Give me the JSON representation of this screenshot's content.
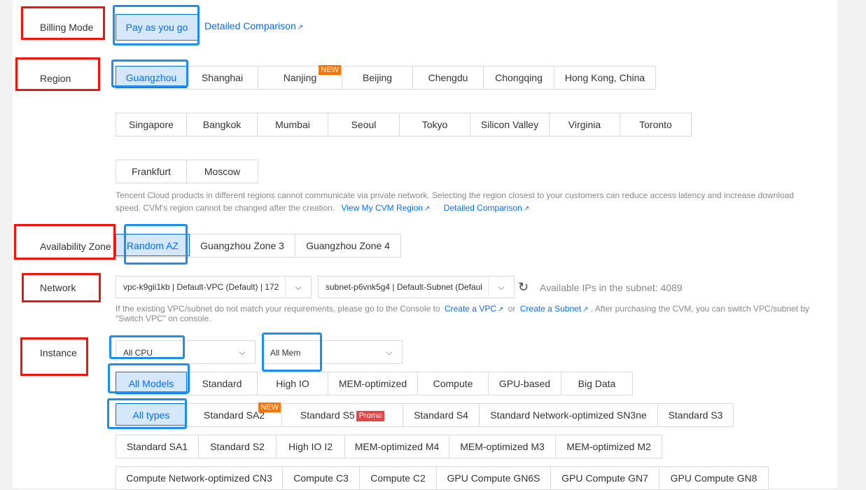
{
  "billing": {
    "label": "Billing Mode",
    "option": "Pay as you go",
    "comparison_link": "Detailed Comparison"
  },
  "region": {
    "label": "Region",
    "row1": [
      "Guangzhou",
      "Shanghai",
      "Nanjing",
      "Beijing",
      "Chengdu",
      "Chongqing",
      "Hong Kong, China"
    ],
    "row2": [
      "Singapore",
      "Bangkok",
      "Mumbai",
      "Seoul",
      "Tokyo",
      "Silicon Valley",
      "Virginia",
      "Toronto"
    ],
    "row3": [
      "Frankfurt",
      "Moscow"
    ],
    "new_badge": "NEW",
    "selected": "Guangzhou",
    "help_line1": "Tencent Cloud products in different regions cannot communicate via private network. Selecting the region closest to your customers can reduce access latency and increase download",
    "help_line2": "speed. CVM's region cannot be changed after the creation.",
    "link_region": "View My CVM Region",
    "link_comparison": "Detailed Comparison"
  },
  "az": {
    "label": "Availability Zone",
    "options": [
      "Random AZ",
      "Guangzhou Zone 3",
      "Guangzhou Zone 4"
    ],
    "selected": "Random AZ"
  },
  "network": {
    "label": "Network",
    "vpc_value": "vpc-k9gii1kb | Default-VPC (Default) | 172",
    "subnet_value": "subnet-p6vnk5g4 | Default-Subnet (Defaul",
    "available_ips": "Available IPs in the subnet: 4089",
    "help_pre": "If the existing VPC/subnet do not match your requirements, please go to the Console to",
    "link_vpc": "Create a VPC",
    "or": "or",
    "link_subnet": "Create a Subnet",
    "help_post": ". After purchasing the CVM, you can switch VPC/subnet by",
    "help_line2": "\"Switch VPC\" on console."
  },
  "instance": {
    "label": "Instance",
    "cpu_select": "All CPU",
    "mem_select": "All Mem",
    "models": [
      "All Models",
      "Standard",
      "High IO",
      "MEM-optimized",
      "Compute",
      "GPU-based",
      "Big Data"
    ],
    "types_row1": [
      "All types",
      "Standard SA2",
      "Standard S5",
      "Standard S4",
      "Standard Network-optimized SN3ne",
      "Standard S3"
    ],
    "types_row2": [
      "Standard SA1",
      "Standard S2",
      "High IO I2",
      "MEM-optimized M4",
      "MEM-optimized M3",
      "MEM-optimized M2"
    ],
    "types_row3": [
      "Compute Network-optimized CN3",
      "Compute C3",
      "Compute C2",
      "GPU Compute GN6S",
      "GPU Compute GN7",
      "GPU Compute GN8"
    ],
    "new_badge": "NEW",
    "promo_badge": "Promo"
  },
  "colors": {
    "accent": "#006eff",
    "selected_bg": "#d5e7fa",
    "annotation_red": "#f0140a",
    "annotation_blue": "#1e8df0",
    "new_badge": "#ff7200",
    "promo_badge": "#e54545"
  },
  "icons": {
    "external": "external-link-icon",
    "dropdown": "chevron-down-icon",
    "refresh": "refresh-icon"
  }
}
